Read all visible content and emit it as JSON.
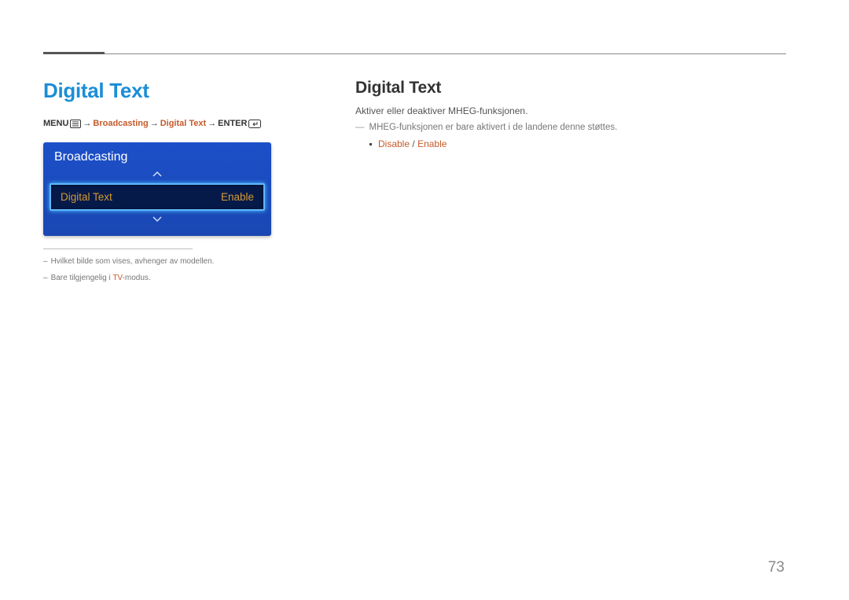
{
  "page_number": "73",
  "left": {
    "title": "Digital Text",
    "breadcrumb": {
      "menu_label": "MENU",
      "arrow": "→",
      "item1": "Broadcasting",
      "item2": "Digital Text",
      "enter_label": "ENTER"
    },
    "panel": {
      "title": "Broadcasting",
      "row_label": "Digital Text",
      "row_value": "Enable"
    },
    "notes": {
      "n1": "Hvilket bilde som vises, avhenger av modellen.",
      "n2_pre": "Bare tilgjengelig i ",
      "n2_hl": "TV",
      "n2_post": "-modus."
    }
  },
  "right": {
    "title": "Digital Text",
    "desc": "Aktiver eller deaktiver MHEG-funksjonen.",
    "sub": "MHEG-funksjonen er bare aktivert i de landene denne støttes.",
    "opts": {
      "a": "Disable",
      "sep": "/",
      "b": "Enable"
    }
  }
}
